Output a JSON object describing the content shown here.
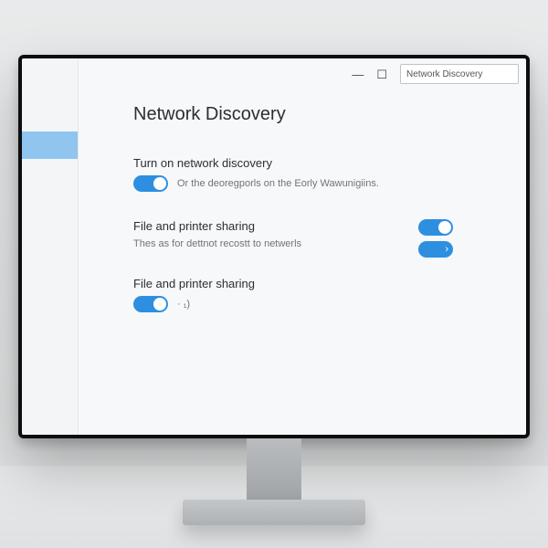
{
  "titlebar": {
    "search_value": "Network Discovery"
  },
  "main": {
    "title": "Network Discovery",
    "settings": [
      {
        "title": "Turn on network discovery",
        "description": "Or the deoregporls on the Eorly Wawunigiins.",
        "toggle": "on"
      },
      {
        "title": "File and printer sharing",
        "description": "Thes as for dettnot recostt to netwerls",
        "toggle": "on"
      },
      {
        "title": "File and printer sharing",
        "hint": "·   ₁)",
        "toggle": "on"
      }
    ]
  },
  "colors": {
    "accent": "#2e8fe0",
    "sidebar_active": "#8fc5ef",
    "text": "#2b2f33",
    "muted": "#6f7579",
    "background": "#f6f8fa"
  }
}
